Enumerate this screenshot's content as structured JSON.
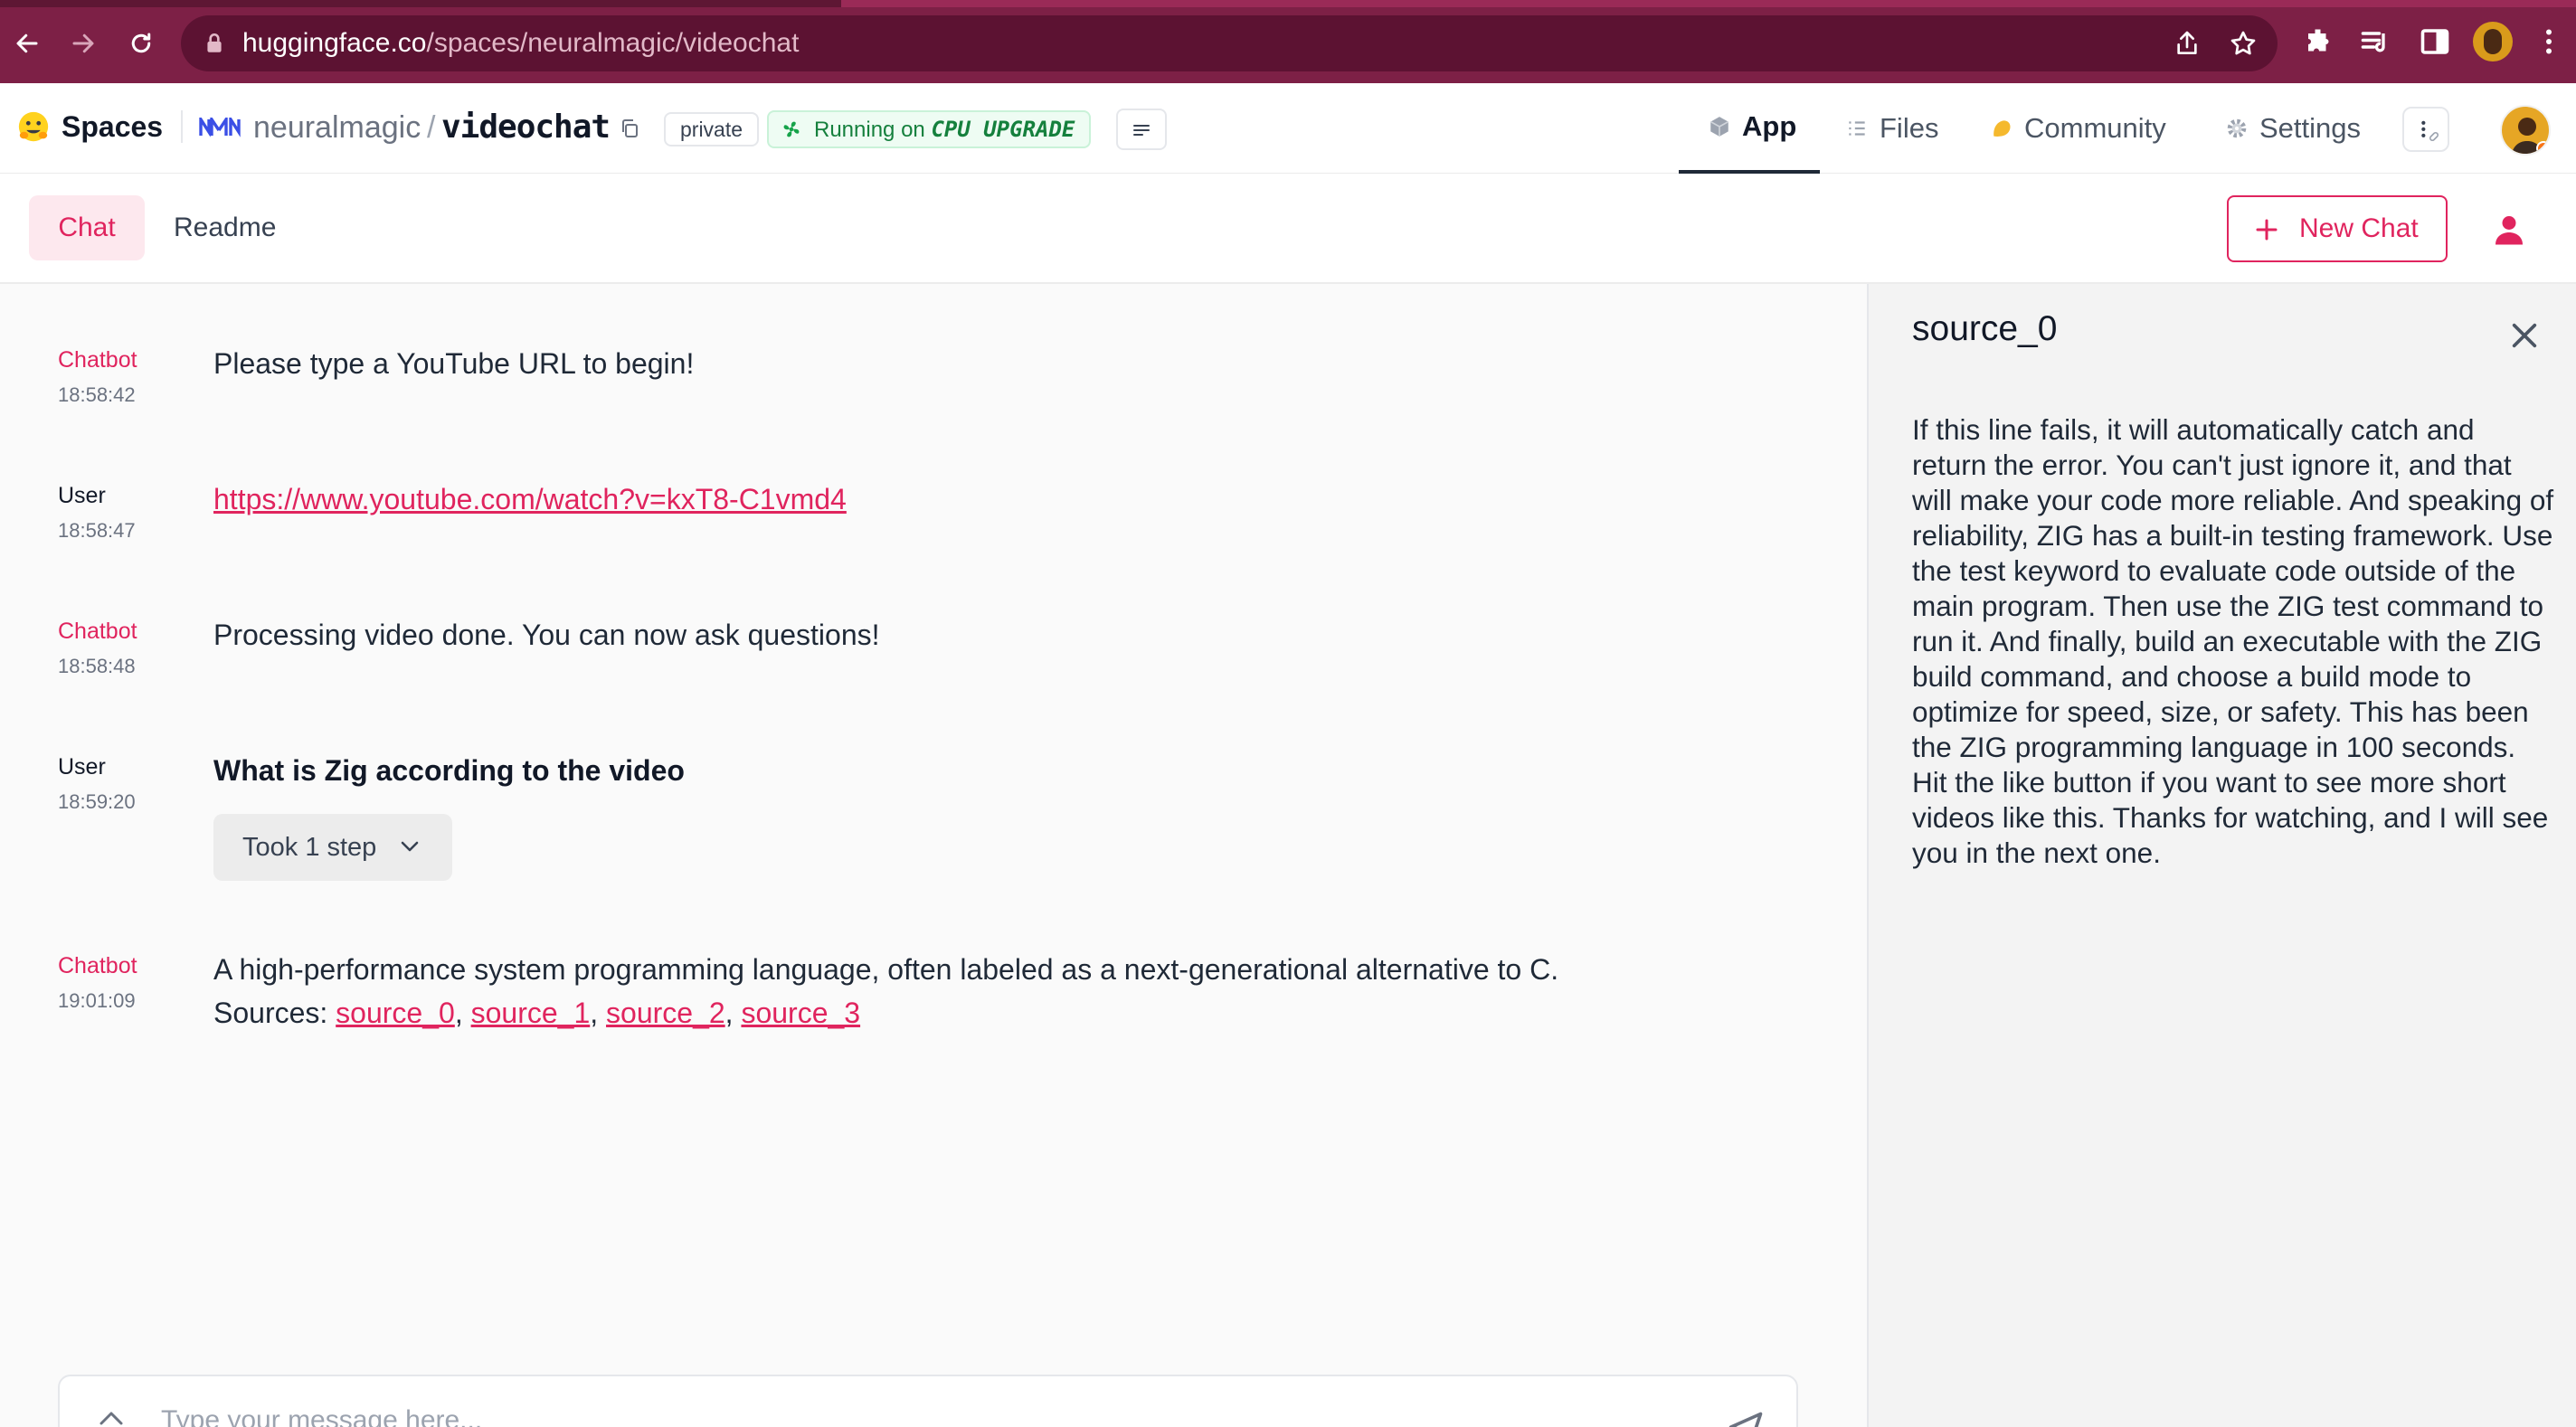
{
  "browser": {
    "url_host": "huggingface.co",
    "url_path": "/spaces/neuralmagic/videochat"
  },
  "header": {
    "spaces_label": "Spaces",
    "org": "neuralmagic",
    "separator": "/",
    "repo": "videochat",
    "visibility": "private",
    "status_text": "Running on ",
    "hardware": "CPU UPGRADE",
    "tabs": [
      {
        "label": "App",
        "icon": "cube-icon"
      },
      {
        "label": "Files",
        "icon": "files-icon"
      },
      {
        "label": "Community",
        "icon": "community-icon"
      },
      {
        "label": "Settings",
        "icon": "gear-icon"
      }
    ]
  },
  "app": {
    "tabs": [
      "Chat",
      "Readme"
    ],
    "new_chat_label": "New Chat"
  },
  "chat": {
    "messages": [
      {
        "role": "Chatbot",
        "time": "18:58:42",
        "text": "Please type a YouTube URL to begin!"
      },
      {
        "role": "User",
        "time": "18:58:47",
        "text": "https://www.youtube.com/watch?v=kxT8-C1vmd4"
      },
      {
        "role": "Chatbot",
        "time": "18:58:48",
        "text": "Processing video done. You can now ask questions!"
      },
      {
        "role": "User",
        "time": "18:59:20",
        "text": "What is Zig according to the video",
        "steps_label": "Took 1 step"
      },
      {
        "role": "Chatbot",
        "time": "19:01:09",
        "text": "A high-performance system programming language, often labeled as a next-generational alternative to C.",
        "sources_label": "Sources:",
        "sources": [
          "source_0",
          "source_1",
          "source_2",
          "source_3"
        ],
        "source_sep": ","
      }
    ],
    "input_placeholder": "Type your message here..."
  },
  "source_panel": {
    "title": "source_0",
    "text": "If this line fails, it will automatically catch and return the error. You can't just ignore it, and that will make your code more reliable. And speaking of reliability, ZIG has a built-in testing framework. Use the test keyword to evaluate code outside of the main program. Then use the ZIG test command to run it. And finally, build an executable with the ZIG build command, and choose a build mode to optimize for speed, size, or safety. This has been the ZIG programming language in 100 seconds. Hit the like button if you want to see more short videos like this. Thanks for watching, and I will see you in the next one."
  },
  "colors": {
    "browser": "#7d2046",
    "accent": "#e0245e",
    "running": "#15803d"
  }
}
